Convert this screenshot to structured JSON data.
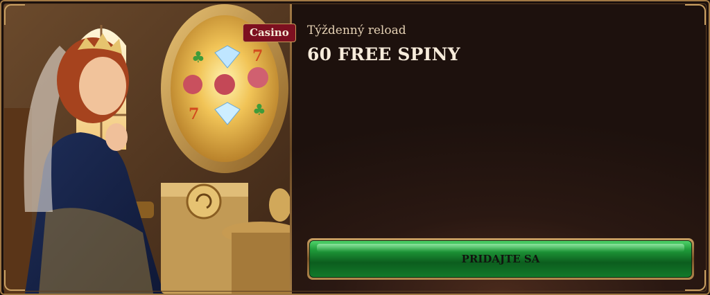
{
  "promo": {
    "badge": "Casino",
    "subtitle": "Týždenný reload",
    "title": "60 FREE SPINY",
    "cta_label": "PRIDAJTE SA"
  },
  "colors": {
    "frame_gold": "#a27a45",
    "badge_red": "#7d1020",
    "panel_bg": "#1d110d",
    "cta_green": "#1f9a39",
    "text_cream": "#f7ecdb"
  },
  "illustration": {
    "subject": "princess-before-slot-mirror",
    "reel_symbols": [
      "clover-icon",
      "diamond-icon",
      "seven-icon",
      "rose-icon",
      "rose-icon",
      "rose-icon",
      "seven-icon",
      "diamond-icon",
      "clover-icon"
    ]
  }
}
